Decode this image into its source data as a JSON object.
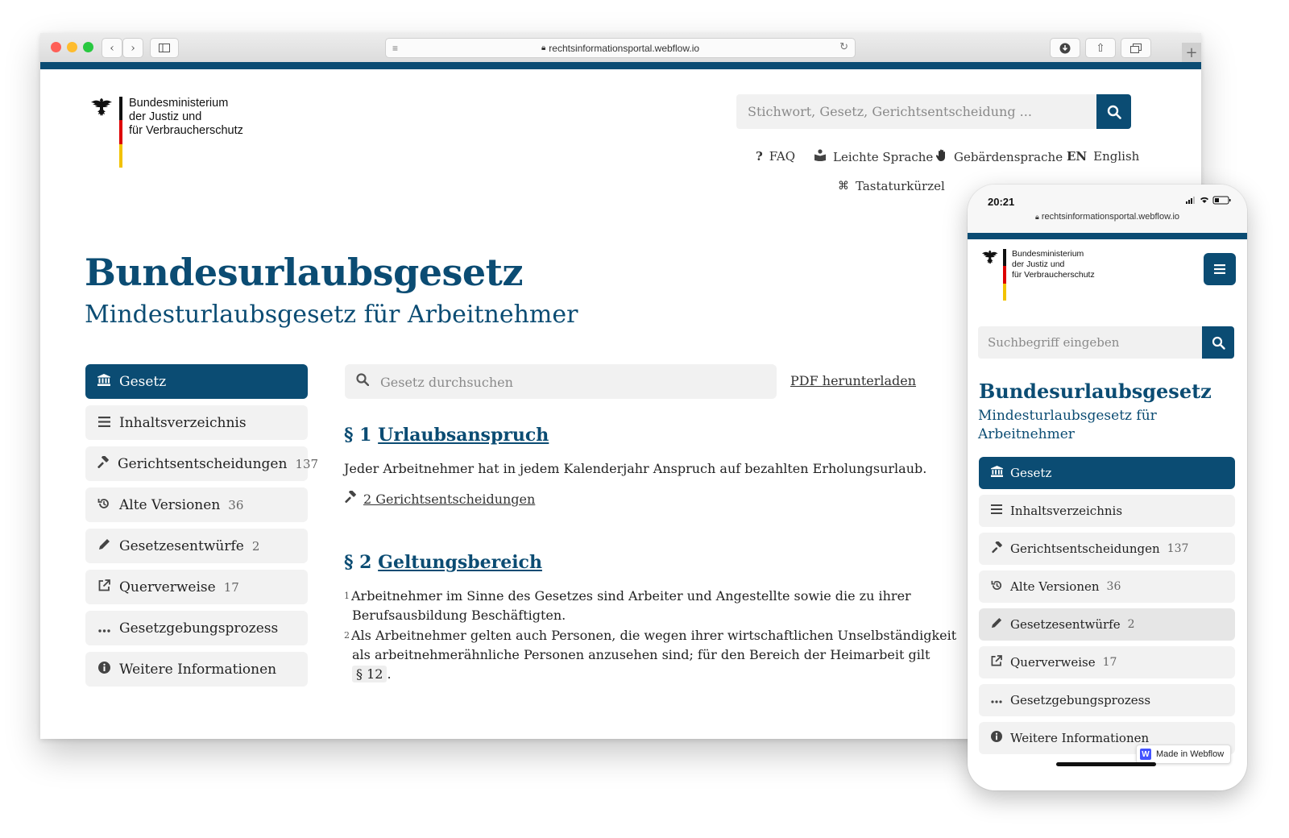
{
  "browser": {
    "url": "rechtsinformationsportal.webflow.io"
  },
  "logo": {
    "line1": "Bundesministerium",
    "line2": "der Justiz und",
    "line3": "für Verbraucherschutz"
  },
  "header": {
    "search_placeholder": "Stichwort, Gesetz, Gerichtsentscheidung ...",
    "links": {
      "faq": "FAQ",
      "easy_language": "Leichte Sprache",
      "sign_language": "Gebärdensprache",
      "lang_code": "EN",
      "lang_label": "English",
      "shortcuts": "Tastaturkürzel"
    }
  },
  "page": {
    "title": "Bundesurlaubsgesetz",
    "subtitle": "Mindesturlaubsgesetz für Arbeitnehmer"
  },
  "nav": [
    {
      "label": "Gesetz",
      "count": ""
    },
    {
      "label": "Inhaltsverzeichnis",
      "count": ""
    },
    {
      "label": "Gerichtsentscheidungen",
      "count": "137"
    },
    {
      "label": "Alte Versionen",
      "count": "36"
    },
    {
      "label": "Gesetzesentwürfe",
      "count": "2"
    },
    {
      "label": "Querverweise",
      "count": "17"
    },
    {
      "label": "Gesetzgebungsprozess",
      "count": ""
    },
    {
      "label": "Weitere Informationen",
      "count": ""
    }
  ],
  "content": {
    "law_search_placeholder": "Gesetz durchsuchen",
    "pdf_label": "PDF herunterladen",
    "sections": [
      {
        "number": "§ 1",
        "title": "Urlaubsanspruch",
        "text": "Jeder Arbeitnehmer hat in jedem Kalenderjahr Anspruch auf bezahlten Erholungsurlaub.",
        "court_link": "2 Gerichtsentscheidungen"
      },
      {
        "number": "§ 2",
        "title": "Geltungsbereich",
        "p1_no": "1",
        "p1": "Arbeitnehmer im Sinne des Gesetzes sind Arbeiter und Angestellte sowie die zu ihrer",
        "p1b": "Berufsausbildung Beschäftigten.",
        "p2_no": "2",
        "p2": "Als Arbeitnehmer gelten auch Personen, die wegen ihrer wirtschaftlichen Unselbständigkeit",
        "p2b": "als arbeitnehmerähnliche Personen anzusehen sind; für den Bereich der Heimarbeit gilt",
        "ref": "§ 12",
        "ref_end": "."
      }
    ]
  },
  "mobile": {
    "time": "20:21",
    "url": "rechtsinformationsportal.webflow.io",
    "search_placeholder": "Suchbegriff eingeben",
    "subtitle_line1": "Mindesturlaubsgesetz für",
    "subtitle_line2": "Arbeitnehmer",
    "badge": "Made in Webflow",
    "badge_logo": "W"
  },
  "colors": {
    "brand_blue": "#0b4c73",
    "nav_bg": "#f2f2f2"
  },
  "icons": {
    "gesetz": "bank-icon",
    "inhalt": "list-icon",
    "gericht": "gavel-icon",
    "versionen": "history-icon",
    "entwuerfe": "pencil-icon",
    "querverweise": "external-link-icon",
    "prozess": "ellipsis-icon",
    "info": "info-icon"
  }
}
